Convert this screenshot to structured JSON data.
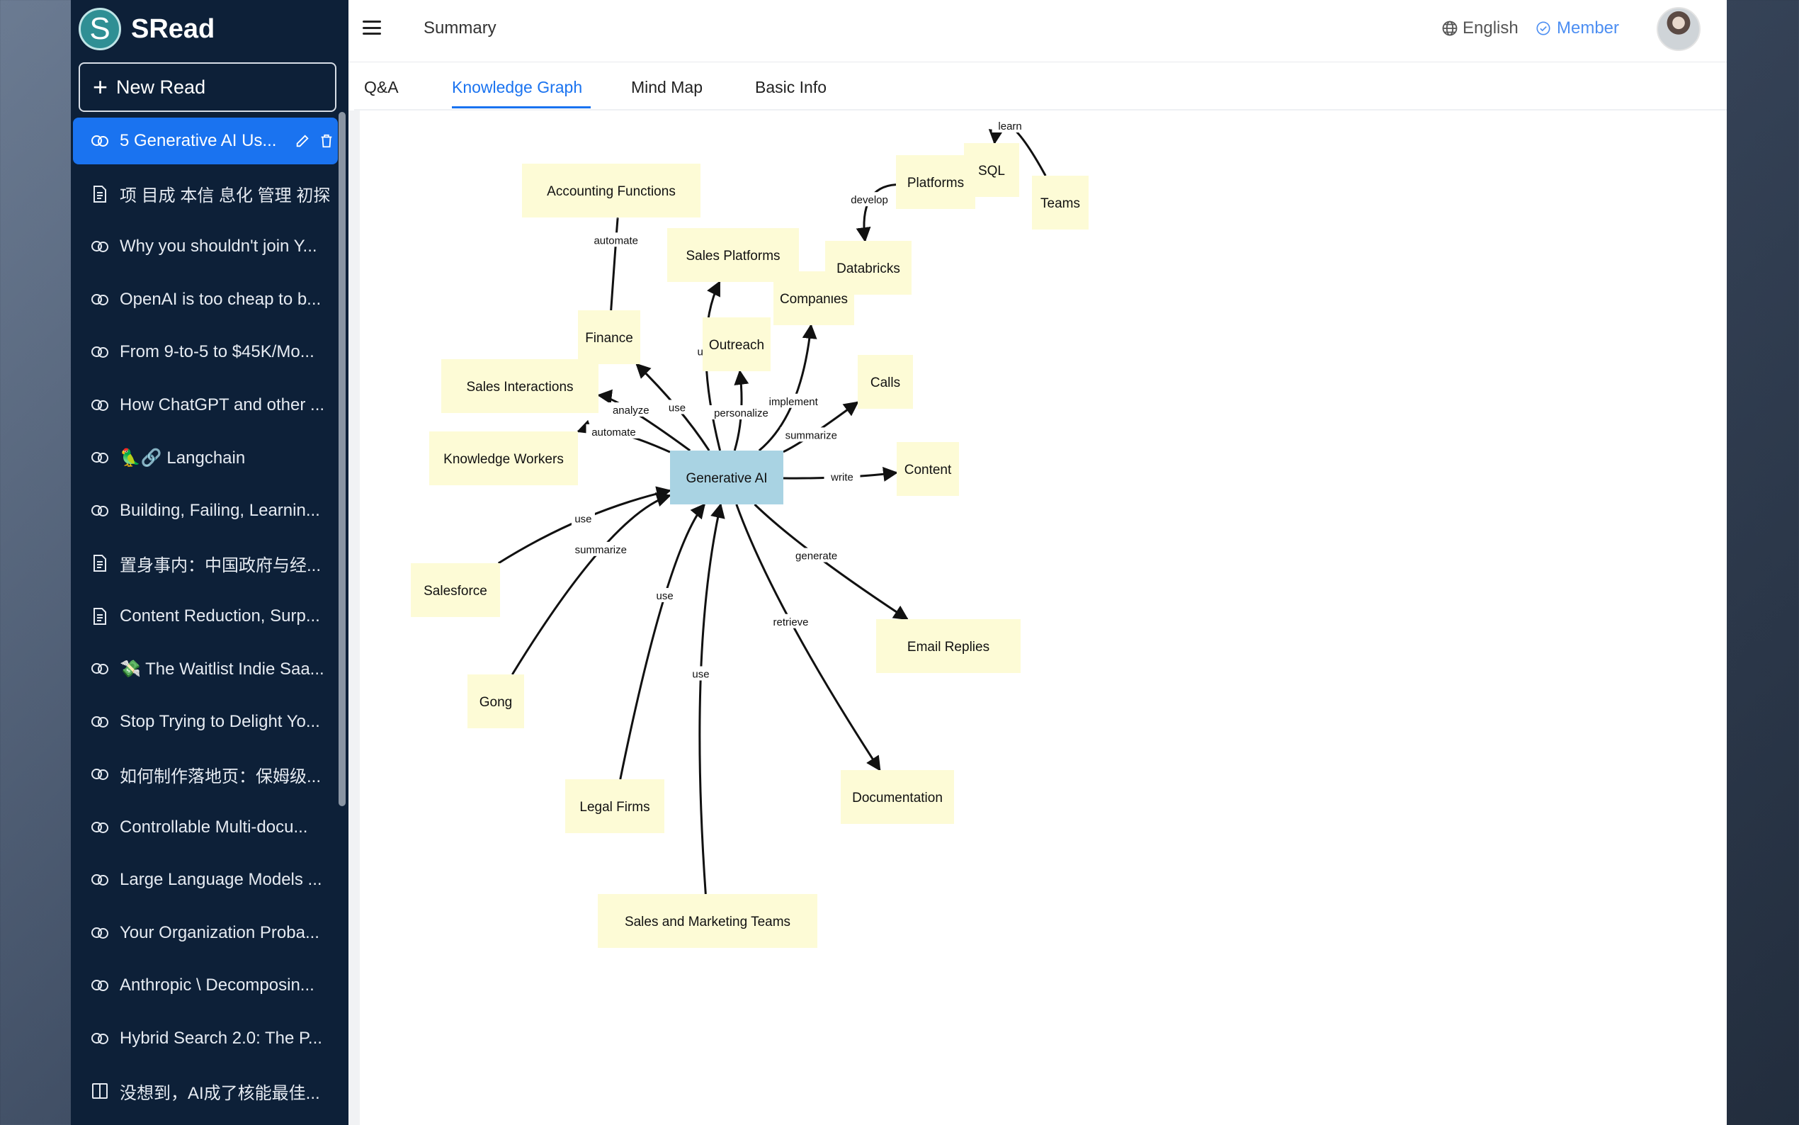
{
  "app": {
    "name": "SRead",
    "logo_letter": "S"
  },
  "sidebar": {
    "new_read_label": "New Read",
    "items": [
      {
        "label": "5 Generative AI Us...",
        "icon": "link-icon",
        "active": true
      },
      {
        "label": "项 目成 本信 息化 管理 初探",
        "icon": "document-icon"
      },
      {
        "label": "Why you shouldn't join Y...",
        "icon": "link-icon"
      },
      {
        "label": "OpenAI is too cheap to b...",
        "icon": "link-icon"
      },
      {
        "label": "From 9-to-5 to $45K/Mo...",
        "icon": "link-icon"
      },
      {
        "label": "How ChatGPT and other ...",
        "icon": "link-icon"
      },
      {
        "label": "🦜🔗 Langchain",
        "icon": "link-icon"
      },
      {
        "label": "Building, Failing, Learnin...",
        "icon": "link-icon"
      },
      {
        "label": "置身事内：中国政府与经...",
        "icon": "document-icon"
      },
      {
        "label": "Content Reduction, Surp...",
        "icon": "document-icon"
      },
      {
        "label": "💸 The Waitlist Indie Saa...",
        "icon": "link-icon"
      },
      {
        "label": "Stop Trying to Delight Yo...",
        "icon": "link-icon"
      },
      {
        "label": "如何制作落地页：保姆级...",
        "icon": "link-icon"
      },
      {
        "label": "Controllable Multi-docu...",
        "icon": "link-icon"
      },
      {
        "label": "Large Language Models ...",
        "icon": "link-icon"
      },
      {
        "label": "Your Organization Proba...",
        "icon": "link-icon"
      },
      {
        "label": "Anthropic \\ Decomposin...",
        "icon": "link-icon"
      },
      {
        "label": "Hybrid Search 2.0: The P...",
        "icon": "link-icon"
      },
      {
        "label": "没想到，AI成了核能最佳...",
        "icon": "book-icon"
      }
    ]
  },
  "header": {
    "title": "Summary",
    "language": "English",
    "member": "Member"
  },
  "tabs": [
    {
      "label": "Q&A"
    },
    {
      "label": "Knowledge Graph",
      "active": true
    },
    {
      "label": "Mind Map"
    },
    {
      "label": "Basic Info"
    }
  ],
  "graph": {
    "nodes": [
      {
        "id": "genai",
        "label": "Generative AI",
        "central": true
      },
      {
        "id": "acct",
        "label": "Accounting Functions"
      },
      {
        "id": "salesplat",
        "label": "Sales Platforms"
      },
      {
        "id": "companies",
        "label": "Companies"
      },
      {
        "id": "finance",
        "label": "Finance"
      },
      {
        "id": "outreach",
        "label": "Outreach"
      },
      {
        "id": "salesint",
        "label": "Sales Interactions"
      },
      {
        "id": "calls",
        "label": "Calls"
      },
      {
        "id": "kw",
        "label": "Knowledge Workers"
      },
      {
        "id": "content",
        "label": "Content"
      },
      {
        "id": "salesforce",
        "label": "Salesforce"
      },
      {
        "id": "gong",
        "label": "Gong"
      },
      {
        "id": "email",
        "label": "Email Replies"
      },
      {
        "id": "legal",
        "label": "Legal Firms"
      },
      {
        "id": "docs",
        "label": "Documentation"
      },
      {
        "id": "smt",
        "label": "Sales and Marketing Teams"
      },
      {
        "id": "platforms",
        "label": "Platforms"
      },
      {
        "id": "databricks",
        "label": "Databricks"
      },
      {
        "id": "sql",
        "label": "SQL"
      },
      {
        "id": "teams",
        "label": "Teams"
      }
    ],
    "edges": [
      {
        "from": "finance",
        "to": "acct",
        "label": "automate"
      },
      {
        "from": "genai",
        "to": "finance",
        "label": "use"
      },
      {
        "from": "genai",
        "to": "salesplat",
        "label": "use"
      },
      {
        "from": "genai",
        "to": "outreach",
        "label": "personalize"
      },
      {
        "from": "genai",
        "to": "companies",
        "label": "implement"
      },
      {
        "from": "genai",
        "to": "salesint",
        "label": "analyze"
      },
      {
        "from": "genai",
        "to": "kw",
        "label": "automate"
      },
      {
        "from": "genai",
        "to": "calls",
        "label": "summarize"
      },
      {
        "from": "genai",
        "to": "content",
        "label": "write"
      },
      {
        "from": "salesforce",
        "to": "genai",
        "label": "use"
      },
      {
        "from": "gong",
        "to": "genai",
        "label": "summarize"
      },
      {
        "from": "genai",
        "to": "email",
        "label": "generate"
      },
      {
        "from": "legal",
        "to": "genai",
        "label": "use"
      },
      {
        "from": "genai",
        "to": "docs",
        "label": "retrieve"
      },
      {
        "from": "smt",
        "to": "genai",
        "label": "use"
      },
      {
        "from": "platforms",
        "to": "databricks",
        "label": "develop"
      },
      {
        "from": "teams",
        "to": "sql",
        "label": "learn"
      }
    ]
  },
  "colors": {
    "sidebar_bg": "#0d2038",
    "accent": "#1a73f0",
    "node_fill": "#fdfbd6",
    "central_node_fill": "#a9d3e3"
  }
}
